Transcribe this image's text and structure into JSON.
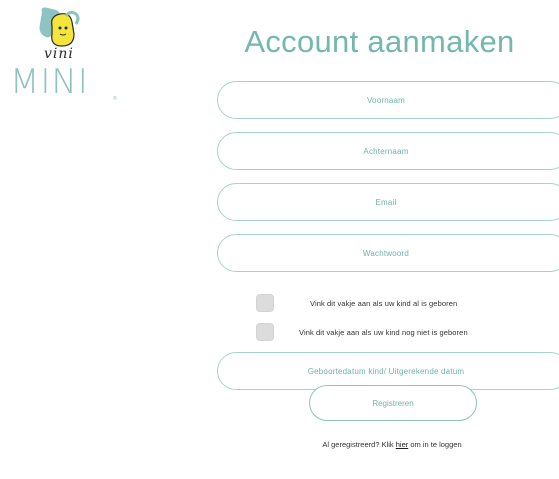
{
  "brand": {
    "script_text": "vini",
    "wordmark": "MINI",
    "registered": "®",
    "colors": {
      "teal": "#8fc3c1",
      "yellow": "#f4e53a",
      "dark": "#2b2b2b"
    }
  },
  "page": {
    "title": "Account aanmaken",
    "accent": "#74b7ae"
  },
  "form": {
    "first_name": {
      "placeholder": "Voornaam"
    },
    "last_name": {
      "placeholder": "Achternaam"
    },
    "email": {
      "placeholder": "Email"
    },
    "password": {
      "placeholder": "Wachtwoord"
    },
    "born_check": {
      "label": "Vink dit vakje aan als uw kind al is geboren"
    },
    "unborn_check": {
      "label": "Vink dit vakje aan als uw kind nog niet is geboren"
    },
    "birth_date": {
      "placeholder": "Geboortedatum kind/ Uitgerekende datum"
    },
    "submit_label": "Registreren"
  },
  "login": {
    "prefix": "Al geregistreerd? Klik ",
    "link_text": "hier",
    "suffix": " om in te loggen"
  }
}
